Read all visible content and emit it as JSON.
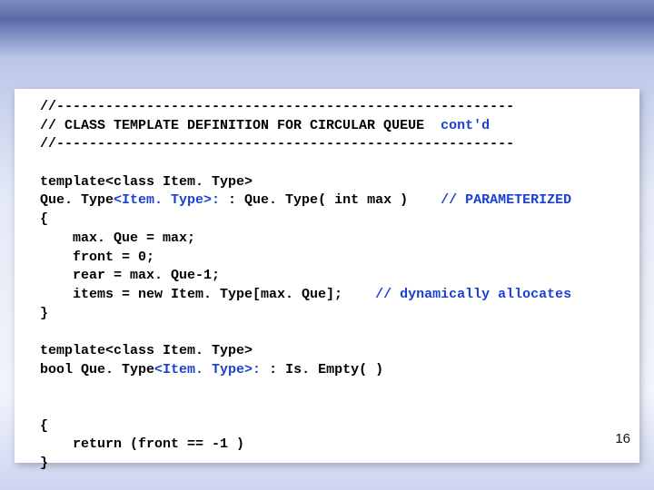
{
  "code": {
    "l01": "//--------------------------------------------------------",
    "l02a": "// CLASS TEMPLATE DEFINITION FOR CIRCULAR QUEUE  ",
    "l02b": "cont'd",
    "l03": "//--------------------------------------------------------",
    "l04": "",
    "l05a": "template<class Item. Type>",
    "l06a": "Que. Type",
    "l06b": "<Item. Type>: ",
    "l06c": ": Que. Type( int max )    ",
    "l06d": "// PARAMETERIZED",
    "l07": "{",
    "l08": "    max. Que = max;",
    "l09": "    front = 0;",
    "l10": "    rear = max. Que-1;",
    "l11a": "    items = new Item. Type[max. Que];    ",
    "l11b": "// dynamically allocates",
    "l12": "}",
    "l13": "",
    "l14a": "template<class Item. Type>",
    "l15a": "bool Que. Type",
    "l15b": "<Item. Type>: ",
    "l15c": ": Is. Empty( )",
    "l16": "",
    "l17": "",
    "l18": "{",
    "l19": "    return (front == -1 )",
    "l20": "}"
  },
  "pagenum": "16"
}
